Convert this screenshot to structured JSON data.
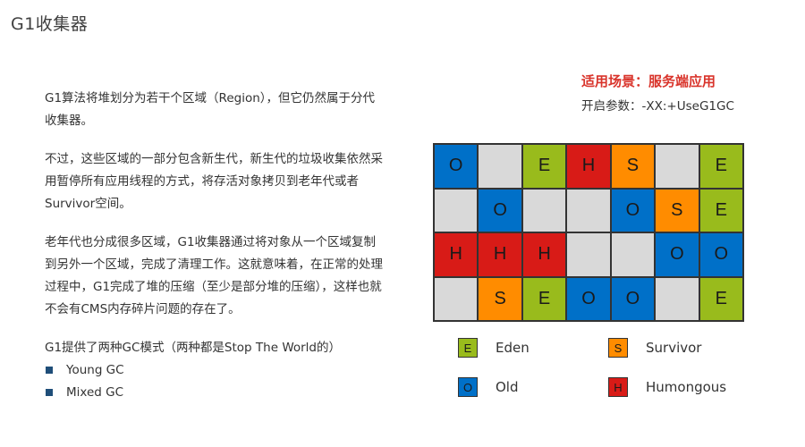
{
  "title": "G1收集器",
  "paragraphs": [
    "G1算法将堆划分为若干个区域（Region），但它仍然属于分代收集器。",
    "不过，这些区域的一部分包含新生代，新生代的垃圾收集依然采用暂停所有应用线程的方式，将存活对象拷贝到老年代或者Survivor空间。",
    "老年代也分成很多区域，G1收集器通过将对象从一个区域复制到另外一个区域，完成了清理工作。这就意味着，在正常的处理过程中，G1完成了堆的压缩（至少是部分堆的压缩），这样也就不会有CMS内存碎片问题的存在了。"
  ],
  "modes_intro": "G1提供了两种GC模式（两种都是Stop The World的）",
  "modes": [
    "Young GC",
    "Mixed GC"
  ],
  "scene": "适用场景：服务端应用",
  "param": "开启参数：-XX:+UseG1GC",
  "grid": [
    [
      "O",
      "",
      "E",
      "H",
      "S",
      "",
      "E"
    ],
    [
      "",
      "O",
      "",
      "",
      "O",
      "S",
      "E"
    ],
    [
      "H",
      "H",
      "H",
      "",
      "",
      "O",
      "O"
    ],
    [
      "",
      "S",
      "E",
      "O",
      "O",
      "",
      "E"
    ]
  ],
  "colors": {
    "E": "#99bb1c",
    "S": "#ff8c00",
    "O": "#0070c8",
    "H": "#d81b17",
    "empty": "#d9d9d9"
  },
  "legend": [
    {
      "code": "E",
      "label": "Eden"
    },
    {
      "code": "S",
      "label": "Survivor"
    },
    {
      "code": "O",
      "label": "Old"
    },
    {
      "code": "H",
      "label": "Humongous"
    }
  ]
}
